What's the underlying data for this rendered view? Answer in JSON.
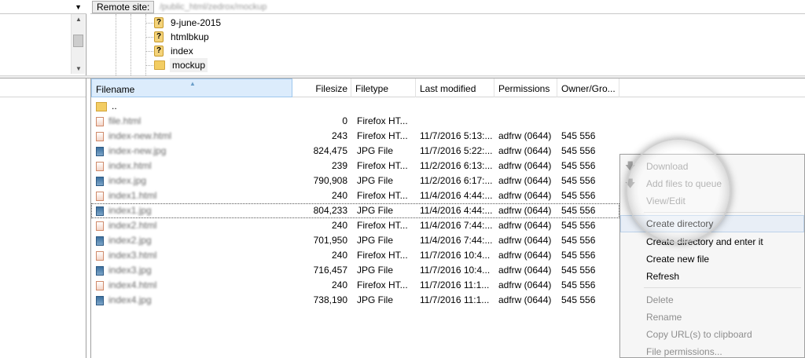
{
  "remote": {
    "label": "Remote site:",
    "path": "/public_html/zedrox/mockup"
  },
  "tree": {
    "items": [
      {
        "label": "9-june-2015",
        "icon": "unknown-folder-icon"
      },
      {
        "label": "htmlbkup",
        "icon": "unknown-folder-icon"
      },
      {
        "label": "index",
        "icon": "unknown-folder-icon"
      },
      {
        "label": "mockup",
        "icon": "folder-icon",
        "selected": true
      }
    ]
  },
  "columns": {
    "filename": "Filename",
    "filesize": "Filesize",
    "filetype": "Filetype",
    "last_modified": "Last modified",
    "permissions": "Permissions",
    "owner": "Owner/Gro..."
  },
  "files": [
    {
      "name": "..",
      "size": "",
      "type": "",
      "modified": "",
      "perm": "",
      "owner": ""
    },
    {
      "name": "file.html",
      "size": "0",
      "type": "Firefox HT...",
      "modified": "",
      "perm": "",
      "owner": ""
    },
    {
      "name": "index-new.html",
      "size": "243",
      "type": "Firefox HT...",
      "modified": "11/7/2016 5:13:...",
      "perm": "adfrw (0644)",
      "owner": "545 556"
    },
    {
      "name": "index-new.jpg",
      "size": "824,475",
      "type": "JPG File",
      "modified": "11/7/2016 5:22:...",
      "perm": "adfrw (0644)",
      "owner": "545 556"
    },
    {
      "name": "index.html",
      "size": "239",
      "type": "Firefox HT...",
      "modified": "11/2/2016 6:13:...",
      "perm": "adfrw (0644)",
      "owner": "545 556"
    },
    {
      "name": "index.jpg",
      "size": "790,908",
      "type": "JPG File",
      "modified": "11/2/2016 6:17:...",
      "perm": "adfrw (0644)",
      "owner": "545 556"
    },
    {
      "name": "index1.html",
      "size": "240",
      "type": "Firefox HT...",
      "modified": "11/4/2016 4:44:...",
      "perm": "adfrw (0644)",
      "owner": "545 556"
    },
    {
      "name": "index1.jpg",
      "size": "804,233",
      "type": "JPG File",
      "modified": "11/4/2016 4:44:...",
      "perm": "adfrw (0644)",
      "owner": "545 556"
    },
    {
      "name": "index2.html",
      "size": "240",
      "type": "Firefox HT...",
      "modified": "11/4/2016 7:44:...",
      "perm": "adfrw (0644)",
      "owner": "545 556"
    },
    {
      "name": "index2.jpg",
      "size": "701,950",
      "type": "JPG File",
      "modified": "11/4/2016 7:44:...",
      "perm": "adfrw (0644)",
      "owner": "545 556"
    },
    {
      "name": "index3.html",
      "size": "240",
      "type": "Firefox HT...",
      "modified": "11/7/2016 10:4...",
      "perm": "adfrw (0644)",
      "owner": "545 556"
    },
    {
      "name": "index3.jpg",
      "size": "716,457",
      "type": "JPG File",
      "modified": "11/7/2016 10:4...",
      "perm": "adfrw (0644)",
      "owner": "545 556"
    },
    {
      "name": "index4.html",
      "size": "240",
      "type": "Firefox HT...",
      "modified": "11/7/2016 11:1...",
      "perm": "adfrw (0644)",
      "owner": "545 556"
    },
    {
      "name": "index4.jpg",
      "size": "738,190",
      "type": "JPG File",
      "modified": "11/7/2016 11:1...",
      "perm": "adfrw (0644)",
      "owner": "545 556"
    }
  ],
  "context_menu": {
    "download": "Download",
    "add_to_queue": "Add files to queue",
    "view_edit": "View/Edit",
    "create_directory": "Create directory",
    "create_directory_enter": "Create directory and enter it",
    "create_new_file": "Create new file",
    "refresh": "Refresh",
    "delete": "Delete",
    "rename": "Rename",
    "copy_urls": "Copy URL(s) to clipboard",
    "file_permissions": "File permissions..."
  }
}
